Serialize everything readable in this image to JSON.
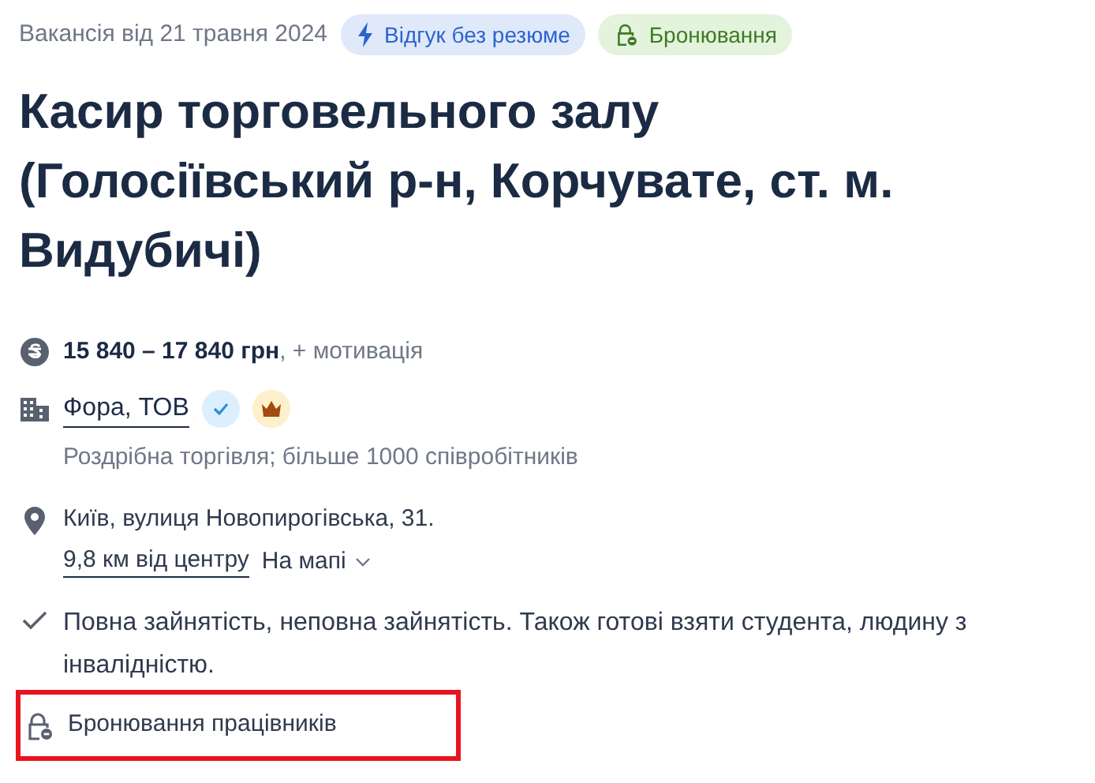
{
  "posted": "Вакансія від 21 травня 2024",
  "badges": [
    {
      "kind": "quick",
      "label": "Відгук без резюме"
    },
    {
      "kind": "booking",
      "label": "Бронювання"
    }
  ],
  "title": "Касир торговельного залу (Голосіївський р-н, Корчувате, ст. м. Видубичі)",
  "salary": {
    "amount": "15 840 – 17 840 грн",
    "extra": ", + мотивація"
  },
  "company": {
    "name": "Фора, ТОВ",
    "verified": true,
    "top": true,
    "description": "Роздрібна торгівля; більше 1000 співробітників"
  },
  "address": {
    "text": "Київ, вулиця Новопирогівська, 31.",
    "distance": "9,8 км від центру",
    "map_link": "На мапі"
  },
  "employment": "Повна зайнятість, неповна зайнятість. Також готові взяти студента, людину з інвалідністю.",
  "booking": {
    "text": "Бронювання працівників",
    "highlighted": true
  }
}
